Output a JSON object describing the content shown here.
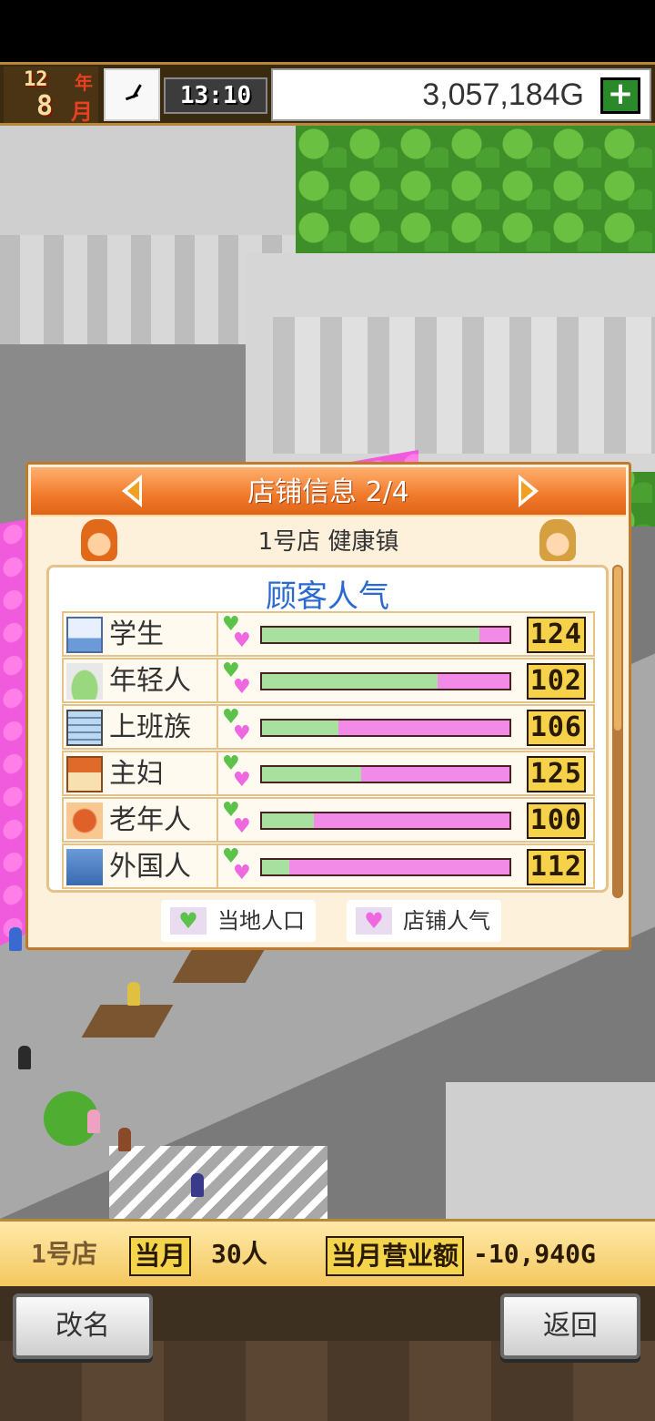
{
  "top_bar": {
    "year_num": "12",
    "year_unit": "年",
    "month_num": "8",
    "month_unit": "月",
    "time": "13:10",
    "money": "3,057,184G",
    "add_button_label": "+"
  },
  "panel": {
    "title": "店铺信息 2/4",
    "store_name": "1号店 健康镇",
    "section_title": "顾客人气",
    "rows": [
      {
        "label": "学生",
        "value": "124",
        "icon": "school-building-icon",
        "local_fraction": 0.88
      },
      {
        "label": "年轻人",
        "value": "102",
        "icon": "sneaker-icon",
        "local_fraction": 0.71
      },
      {
        "label": "上班族",
        "value": "106",
        "icon": "office-building-icon",
        "local_fraction": 0.31
      },
      {
        "label": "主妇",
        "value": "125",
        "icon": "house-icon",
        "local_fraction": 0.4
      },
      {
        "label": "老年人",
        "value": "100",
        "icon": "maple-leaf-icon",
        "local_fraction": 0.21
      },
      {
        "label": "外国人",
        "value": "112",
        "icon": "airplane-icon",
        "local_fraction": 0.11
      }
    ],
    "legend": {
      "local_label": "当地人口",
      "store_label": "店铺人气",
      "local_color": "#5cc24a",
      "store_color": "#ee68e0"
    }
  },
  "bottom_info": {
    "store": "1号店",
    "month_label": "当月",
    "customers": "30人",
    "sales_label": "当月营业额",
    "sales": "-10,940G"
  },
  "buttons": {
    "rename": "改名",
    "back": "返回"
  }
}
